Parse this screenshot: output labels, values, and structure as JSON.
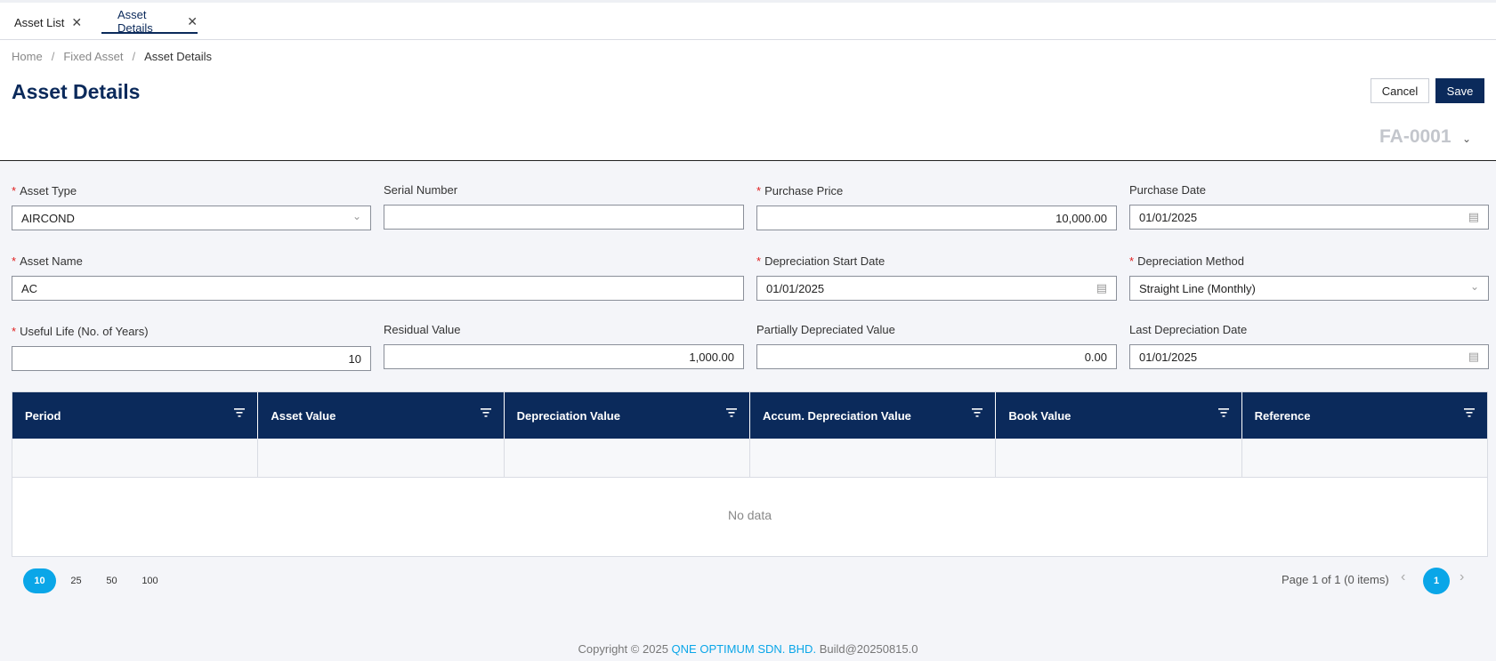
{
  "tabs": [
    {
      "label": "Asset List"
    },
    {
      "label": "Asset Details"
    }
  ],
  "breadcrumb": [
    "Home",
    "Fixed Asset",
    "Asset Details"
  ],
  "page_title": "Asset Details",
  "actions": {
    "cancel": "Cancel",
    "save": "Save"
  },
  "doc_no": "FA-0001",
  "fields": {
    "asset_type": {
      "label": "Asset Type",
      "value": "AIRCOND"
    },
    "serial_number": {
      "label": "Serial Number",
      "value": ""
    },
    "purchase_price": {
      "label": "Purchase Price",
      "value": "10,000.00"
    },
    "purchase_date": {
      "label": "Purchase Date",
      "value": "01/01/2025"
    },
    "asset_name": {
      "label": "Asset Name",
      "value": "AC"
    },
    "depreciation_start_date": {
      "label": "Depreciation Start Date",
      "value": "01/01/2025"
    },
    "depreciation_method": {
      "label": "Depreciation Method",
      "value": "Straight Line (Monthly)"
    },
    "useful_life": {
      "label": "Useful Life (No. of Years)",
      "value": "10"
    },
    "residual_value": {
      "label": "Residual Value",
      "value": "1,000.00"
    },
    "partially_depreciated_value": {
      "label": "Partially Depreciated Value",
      "value": "0.00"
    },
    "last_depreciation_date": {
      "label": "Last Depreciation Date",
      "value": "01/01/2025"
    }
  },
  "grid": {
    "columns": [
      "Period",
      "Asset Value",
      "Depreciation Value",
      "Accum. Depreciation Value",
      "Book Value",
      "Reference"
    ],
    "empty_text": "No data"
  },
  "pager": {
    "sizes": [
      "10",
      "25",
      "50",
      "100"
    ],
    "info": "Page 1 of 1 (0 items)",
    "current_page": "1"
  },
  "footer": {
    "prefix": "Copyright",
    "symbol": "©",
    "year": "2025",
    "company": "QNE OPTIMUM SDN. BHD.",
    "build": "Build@20250815.0"
  },
  "colors": {
    "primary": "#0b2a5b",
    "accent": "#0aa6e8",
    "required": "#e02020"
  }
}
